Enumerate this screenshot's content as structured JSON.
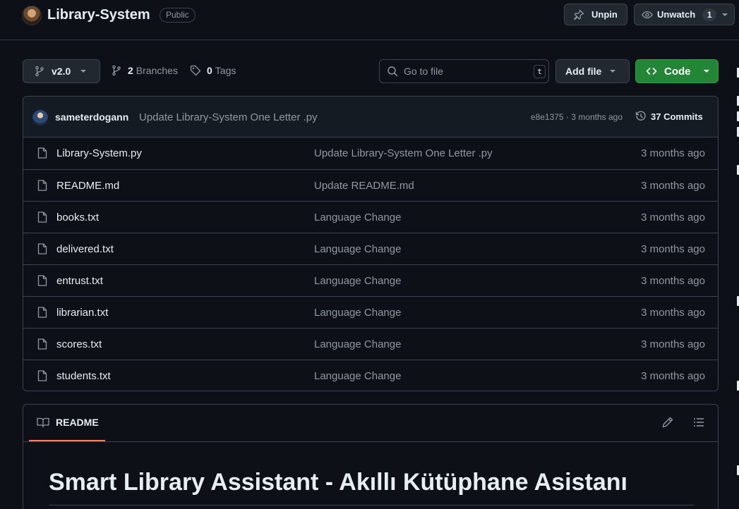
{
  "header": {
    "repo_name": "Library-System",
    "visibility": "Public",
    "unpin_label": "Unpin",
    "unwatch_label": "Unwatch",
    "watch_count": "1"
  },
  "toolbar": {
    "branch": "v2.0",
    "branches_count": "2",
    "branches_label": "Branches",
    "tags_count": "0",
    "tags_label": "Tags",
    "search_placeholder": "Go to file",
    "search_shortcut": "t",
    "add_file_label": "Add file",
    "code_label": "Code"
  },
  "latest_commit": {
    "author": "sameterdogann",
    "message": "Update Library-System One Letter .py",
    "hash_time": "e8e1375 · 3 months ago",
    "commits_label": "37 Commits"
  },
  "files": [
    {
      "name": "Library-System.py",
      "message": "Update Library-System One Letter .py",
      "time": "3 months ago"
    },
    {
      "name": "README.md",
      "message": "Update README.md",
      "time": "3 months ago"
    },
    {
      "name": "books.txt",
      "message": "Language Change",
      "time": "3 months ago"
    },
    {
      "name": "delivered.txt",
      "message": "Language Change",
      "time": "3 months ago"
    },
    {
      "name": "entrust.txt",
      "message": "Language Change",
      "time": "3 months ago"
    },
    {
      "name": "librarian.txt",
      "message": "Language Change",
      "time": "3 months ago"
    },
    {
      "name": "scores.txt",
      "message": "Language Change",
      "time": "3 months ago"
    },
    {
      "name": "students.txt",
      "message": "Language Change",
      "time": "3 months ago"
    }
  ],
  "readme": {
    "tab_label": "README",
    "title": "Smart Library Assistant - Akıllı Kütüphane Asistanı"
  },
  "colors": {
    "background": "#0d1117",
    "code_button": "#238636",
    "readme_tab_underline": "#f78166"
  }
}
